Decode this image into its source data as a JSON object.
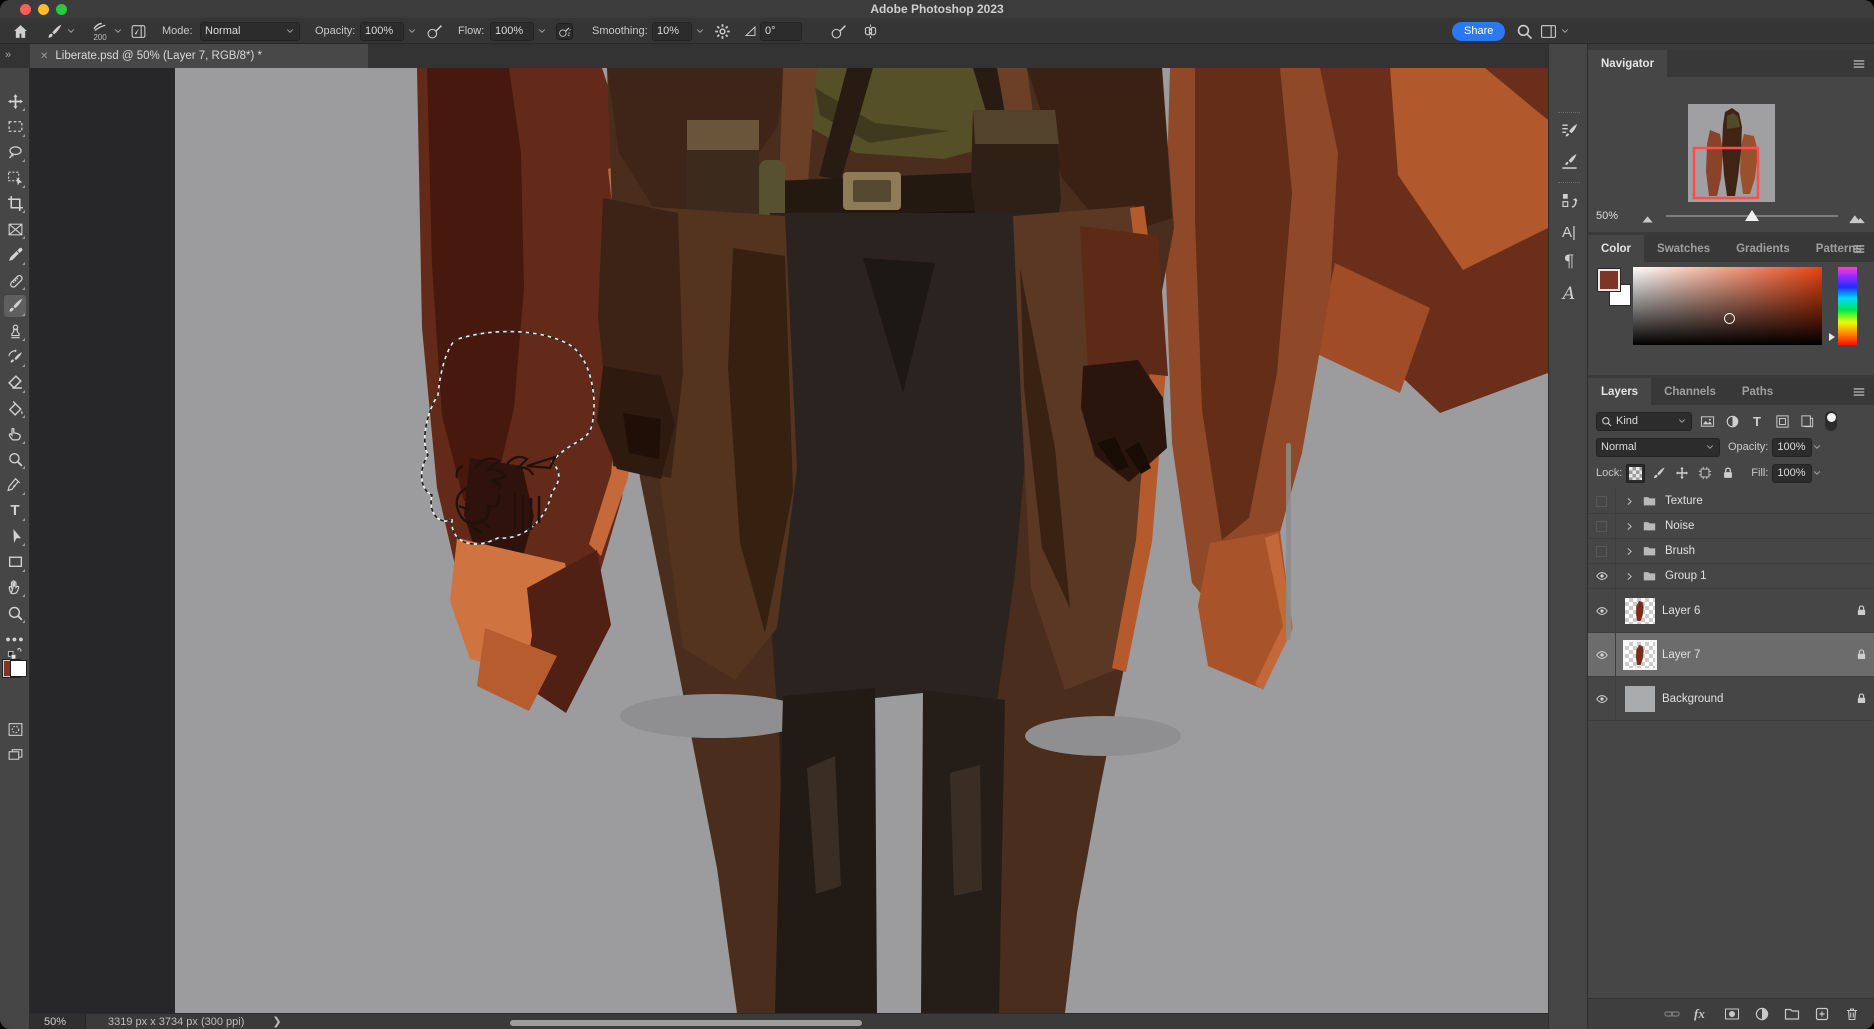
{
  "titlebar": {
    "title": "Adobe Photoshop 2023"
  },
  "options": {
    "brush_size": "200",
    "mode_label": "Mode:",
    "mode_value": "Normal",
    "opacity_label": "Opacity:",
    "opacity_value": "100%",
    "flow_label": "Flow:",
    "flow_value": "100%",
    "smoothing_label": "Smoothing:",
    "smoothing_value": "10%",
    "angle_value": "0°",
    "share_label": "Share"
  },
  "document": {
    "tab_title": "Liberate.psd @ 50% (Layer 7, RGB/8*) *",
    "status_zoom": "50%",
    "status_dims": "3319 px x 3734 px (300 ppi)"
  },
  "toolbar": {
    "tools": [
      {
        "name": "move"
      },
      {
        "name": "rectangular-marquee"
      },
      {
        "name": "lasso"
      },
      {
        "name": "object-selection"
      },
      {
        "name": "crop"
      },
      {
        "name": "frame"
      },
      {
        "name": "eyedropper"
      },
      {
        "name": "spot-healing-brush"
      },
      {
        "name": "brush",
        "selected": true
      },
      {
        "name": "clone-stamp"
      },
      {
        "name": "history-brush"
      },
      {
        "name": "eraser"
      },
      {
        "name": "paint-bucket"
      },
      {
        "name": "smudge"
      },
      {
        "name": "dodge"
      },
      {
        "name": "pen"
      },
      {
        "name": "type"
      },
      {
        "name": "path-selection"
      },
      {
        "name": "rectangle"
      },
      {
        "name": "hand"
      },
      {
        "name": "zoom"
      }
    ],
    "foreground_color": "#7d3526",
    "background_color": "#ffffff"
  },
  "navigator": {
    "title": "Navigator",
    "zoom_value": "50%"
  },
  "color_panel": {
    "tabs": [
      "Color",
      "Swatches",
      "Gradients",
      "Patterns"
    ],
    "foreground": "#7d3526",
    "background": "#ffffff"
  },
  "layers_panel": {
    "tabs": [
      "Layers",
      "Channels",
      "Paths"
    ],
    "filter_label": "Kind",
    "blend_mode": "Normal",
    "opacity_label": "Opacity:",
    "opacity_value": "100%",
    "lock_label": "Lock:",
    "fill_label": "Fill:",
    "fill_value": "100%",
    "layers": [
      {
        "name": "Texture",
        "type": "group",
        "visible": false,
        "locked": false,
        "selected": false
      },
      {
        "name": "Noise",
        "type": "group",
        "visible": false,
        "locked": false,
        "selected": false
      },
      {
        "name": "Brush",
        "type": "group",
        "visible": false,
        "locked": false,
        "selected": false
      },
      {
        "name": "Group 1",
        "type": "group",
        "visible": true,
        "locked": false,
        "selected": false
      },
      {
        "name": "Layer 6",
        "type": "layer",
        "visible": true,
        "locked": true,
        "selected": false,
        "thumb": "figure"
      },
      {
        "name": "Layer 7",
        "type": "layer",
        "visible": true,
        "locked": true,
        "selected": true,
        "thumb": "figure"
      },
      {
        "name": "Background",
        "type": "layer",
        "visible": true,
        "locked": true,
        "selected": false,
        "thumb": "gray"
      }
    ]
  }
}
